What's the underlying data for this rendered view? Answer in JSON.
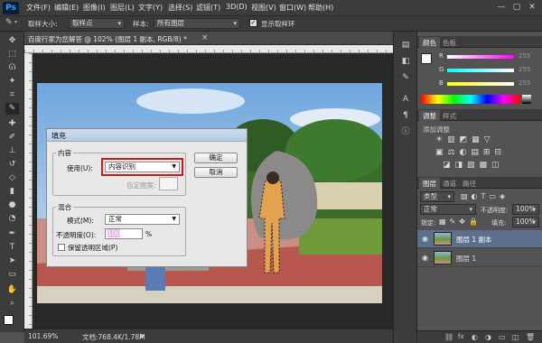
{
  "app": {
    "logo": "Ps"
  },
  "menu": [
    "文件(F)",
    "编辑(E)",
    "图像(I)",
    "图层(L)",
    "文字(Y)",
    "选择(S)",
    "滤镜(T)",
    "3D(D)",
    "视图(V)",
    "窗口(W)",
    "帮助(H)"
  ],
  "window_controls": [
    "—",
    "▢",
    "✕"
  ],
  "options": {
    "sample_size_label": "取样大小:",
    "sample_size_value": "取样点",
    "sample_label": "样本:",
    "sample_value": "所有图层",
    "show_ring_label": "显示取样环",
    "show_ring_checked": true
  },
  "document": {
    "tab_title": "百度行家为您解答 @ 102% (图层 1 副本, RGB/8) *",
    "close": "×"
  },
  "status": {
    "zoom": "101.69%",
    "doc_info": "文档:768.4K/1.78M"
  },
  "color_panel": {
    "tabs": [
      "颜色",
      "色板"
    ],
    "r_label": "R",
    "g_label": "G",
    "b_label": "B",
    "r_value": "255",
    "g_value": "255",
    "b_value": "255"
  },
  "adjust_panel": {
    "tabs": [
      "调整",
      "样式"
    ],
    "title": "添加调整"
  },
  "layers_panel": {
    "tabs": [
      "图层",
      "通道",
      "路径"
    ],
    "filter_kind": "类型",
    "blend_mode": "正常",
    "opacity_label": "不透明度:",
    "opacity_value": "100%",
    "lock_label": "锁定:",
    "fill_label": "填充:",
    "fill_value": "100%",
    "layers": [
      {
        "name": "图层 1 副本",
        "selected": true
      },
      {
        "name": "图层 1",
        "selected": false
      }
    ],
    "footer_icons": [
      "⛓",
      "fx",
      "◐",
      "◑",
      "▭",
      "◫",
      "🗑"
    ]
  },
  "fill_dialog": {
    "title": "填充",
    "content_group": "内容",
    "use_label": "使用(U):",
    "use_value": "内容识别",
    "custom_pattern_label": "自定图案:",
    "ok": "确定",
    "cancel": "取消",
    "blend_group": "混合",
    "mode_label": "模式(M):",
    "mode_value": "正常",
    "opacity_label": "不透明度(O):",
    "opacity_value": "100",
    "opacity_unit": "%",
    "preserve_label": "保留透明区域(P)"
  }
}
